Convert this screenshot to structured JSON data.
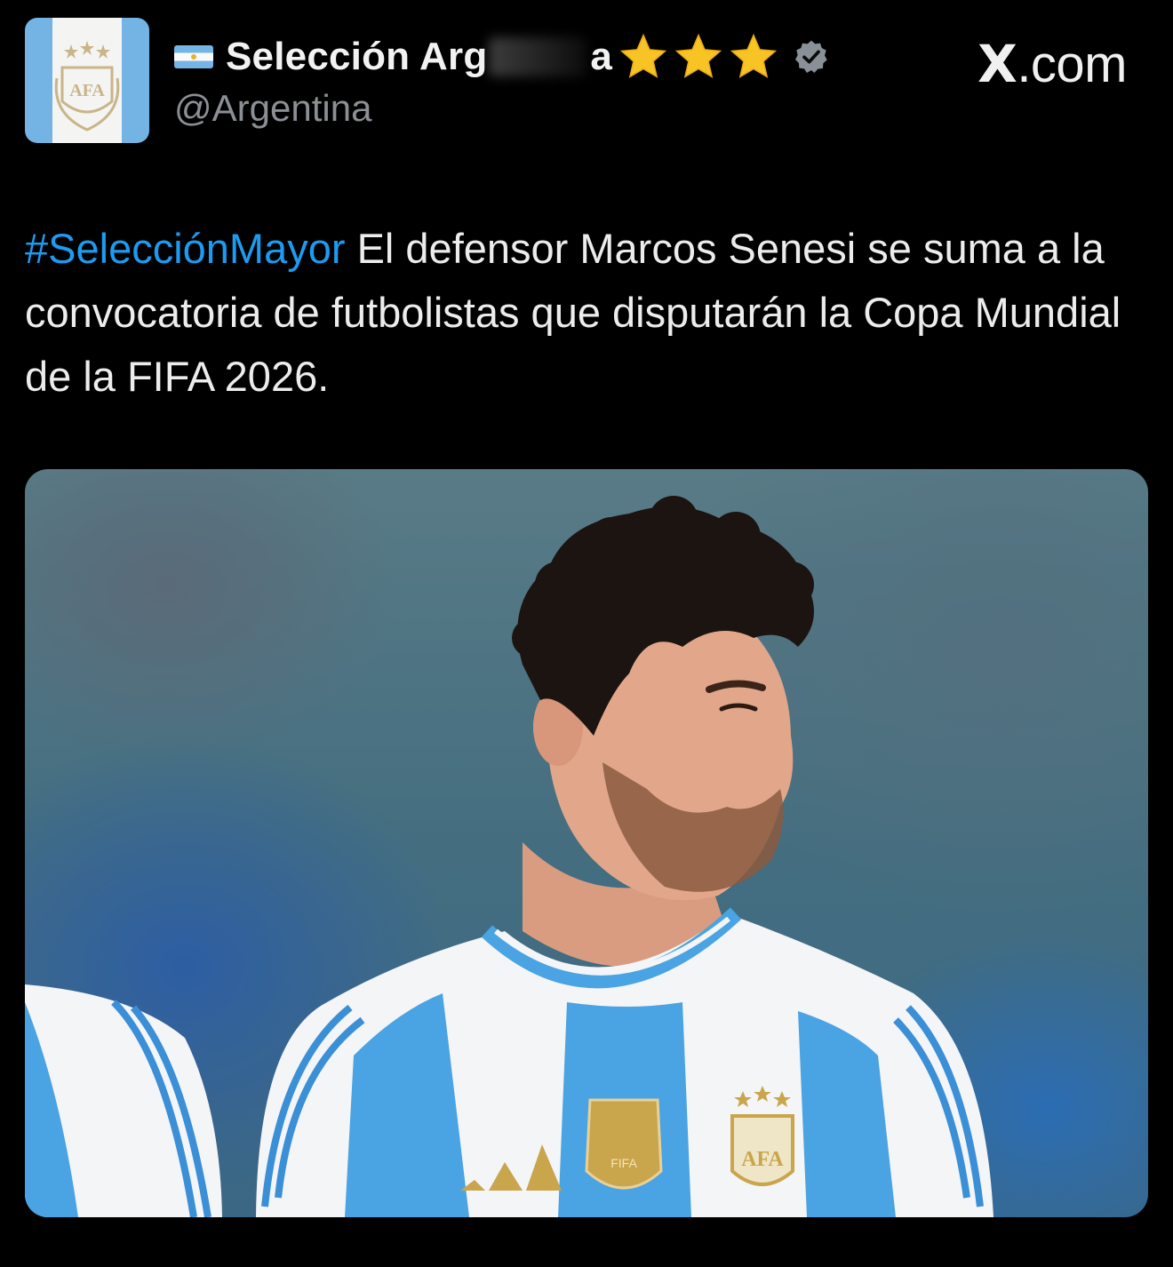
{
  "account": {
    "display_name": "Selección Arg",
    "display_name_tail": "a",
    "handle": "@Argentina",
    "star_count": 3,
    "verified": true,
    "flag_icon": "argentina-flag-icon",
    "avatar_crest_text": "AFA"
  },
  "brand": {
    "x": "X",
    "domain": ".com"
  },
  "tweet": {
    "hashtag": "#SelecciónMayor",
    "text": " El defensor Marcos Senesi se suma a la convocatoria de futbolistas que disputarán la Copa Mundial de la FIFA 2026."
  },
  "media": {
    "kind": "photo",
    "colors": {
      "jersey_sky_blue": "#4aa3e2",
      "jersey_white": "#f3f5f7",
      "crest_gold": "#c9a54b"
    },
    "jersey_badge_text": "FIFA",
    "jersey_crest_text": "AFA"
  },
  "colors": {
    "background": "#000000",
    "link": "#1d9bf0",
    "text": "#e7e9ea",
    "muted": "#8b8f94",
    "star": "#f7c325"
  }
}
